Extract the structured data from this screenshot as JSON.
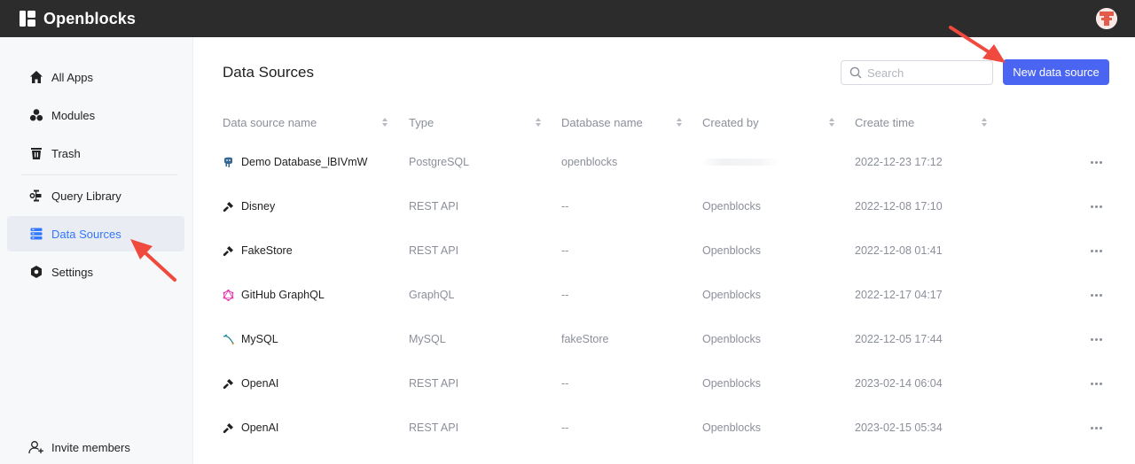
{
  "app": {
    "name": "Openblocks"
  },
  "sidebar": {
    "items": [
      {
        "label": "All Apps",
        "icon": "home-icon"
      },
      {
        "label": "Modules",
        "icon": "modules-icon"
      },
      {
        "label": "Trash",
        "icon": "trash-icon"
      },
      {
        "label": "Query Library",
        "icon": "query-library-icon"
      },
      {
        "label": "Data Sources",
        "icon": "data-sources-icon",
        "active": true
      },
      {
        "label": "Settings",
        "icon": "settings-icon"
      }
    ],
    "invite_label": "Invite members"
  },
  "main": {
    "title": "Data Sources",
    "search_placeholder": "Search",
    "new_button_label": "New data source",
    "columns": [
      "Data source name",
      "Type",
      "Database name",
      "Created by",
      "Create time"
    ],
    "rows": [
      {
        "name": "Demo Database_lBIVmW",
        "icon": "postgresql-icon",
        "type": "PostgreSQL",
        "database": "openblocks",
        "created_by": "",
        "create_time": "2022-12-23 17:12"
      },
      {
        "name": "Disney",
        "icon": "rest-api-icon",
        "type": "REST API",
        "database": "--",
        "created_by": "Openblocks",
        "create_time": "2022-12-08 17:10"
      },
      {
        "name": "FakeStore",
        "icon": "rest-api-icon",
        "type": "REST API",
        "database": "--",
        "created_by": "Openblocks",
        "create_time": "2022-12-08 01:41"
      },
      {
        "name": "GitHub GraphQL",
        "icon": "graphql-icon",
        "type": "GraphQL",
        "database": "--",
        "created_by": "Openblocks",
        "create_time": "2022-12-17 04:17"
      },
      {
        "name": "MySQL",
        "icon": "mysql-icon",
        "type": "MySQL",
        "database": "fakeStore",
        "created_by": "Openblocks",
        "create_time": "2022-12-05 17:44"
      },
      {
        "name": "OpenAI",
        "icon": "rest-api-icon",
        "type": "REST API",
        "database": "--",
        "created_by": "Openblocks",
        "create_time": "2023-02-14 06:04"
      },
      {
        "name": "OpenAI",
        "icon": "rest-api-icon",
        "type": "REST API",
        "database": "--",
        "created_by": "Openblocks",
        "create_time": "2023-02-15 05:34"
      }
    ]
  },
  "colors": {
    "topbar": "#2c2c2c",
    "accent": "#4965f2",
    "active_nav": "#3377ff",
    "annotation_arrow": "#f04a3e"
  }
}
